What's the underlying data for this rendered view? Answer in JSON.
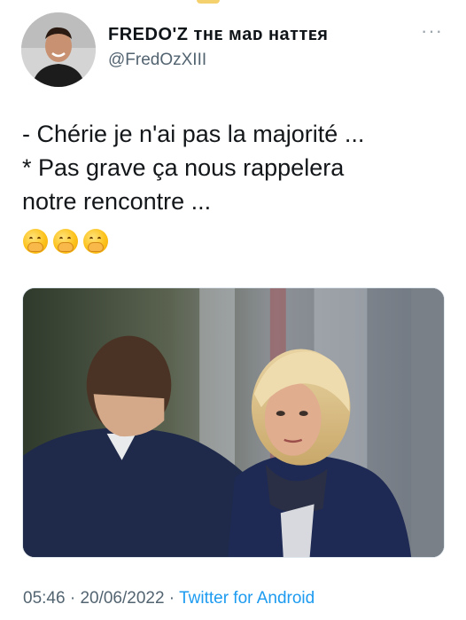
{
  "user": {
    "display_name": "FREDO'Z ᴛʜᴇ ᴍaᴅ ʜaᴛᴛᴇя",
    "handle": "@FredOzXIII"
  },
  "tweet": {
    "lines": [
      "- Chérie je n'ai pas la majorité ...",
      "* Pas grave ça nous rappelera",
      "notre rencontre ..."
    ],
    "emojis": [
      "face-with-hand-over-mouth",
      "face-with-hand-over-mouth",
      "face-with-hand-over-mouth"
    ]
  },
  "meta": {
    "time": "05:46",
    "separator": " · ",
    "date": "20/06/2022",
    "source": "Twitter for Android"
  },
  "icons": {
    "more": "more-options-icon"
  },
  "colors": {
    "text": "#0f1419",
    "secondary": "#536471",
    "link": "#1d9bf0"
  }
}
